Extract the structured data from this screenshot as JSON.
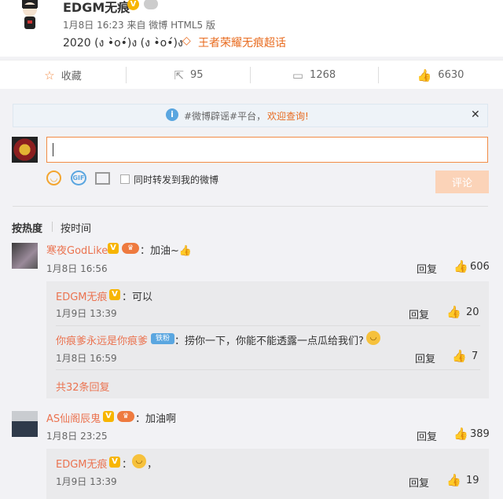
{
  "post": {
    "author": "EDGM无痕",
    "meta": "1月8日 16:23 来自 微博 HTML5 版",
    "text": "2020 (ง •̀o•́)ง (ง •̀o•́)ง",
    "topic": "王者荣耀无痕超话"
  },
  "actions": {
    "favorite": "收藏",
    "repost": "95",
    "comment": "1268",
    "like": "6630"
  },
  "notice": {
    "text": "#微博辟谣#平台，",
    "link": "欢迎查询!"
  },
  "composer": {
    "checkbox_label": "同时转发到我的微博",
    "submit_label": "评论"
  },
  "sort": {
    "hot": "按热度",
    "time": "按时间"
  },
  "comments": [
    {
      "user": "寒夜GodLike",
      "text": "：加油~👍",
      "time": "1月8日 16:56",
      "reply_label": "回复",
      "likes": "606",
      "replies": [
        {
          "user": "EDGM无痕",
          "text": "：可以",
          "time": "1月9日 13:39",
          "reply_label": "回复",
          "likes": "20"
        },
        {
          "user": "你痕爹永远是你痕爹",
          "badge": "铁粉",
          "text": "：捞你一下，你能不能透露一点瓜给我们?",
          "time": "1月8日 16:59",
          "reply_label": "回复",
          "likes": "7"
        }
      ],
      "more": "共32条回复"
    },
    {
      "user": "AS仙阁辰鬼",
      "text": "：加油啊",
      "time": "1月8日 23:25",
      "reply_label": "回复",
      "likes": "389",
      "replies": [
        {
          "user": "EDGM无痕",
          "text": "，",
          "time": "1月9日 13:39",
          "reply_label": "回复",
          "likes": "19"
        }
      ]
    }
  ]
}
